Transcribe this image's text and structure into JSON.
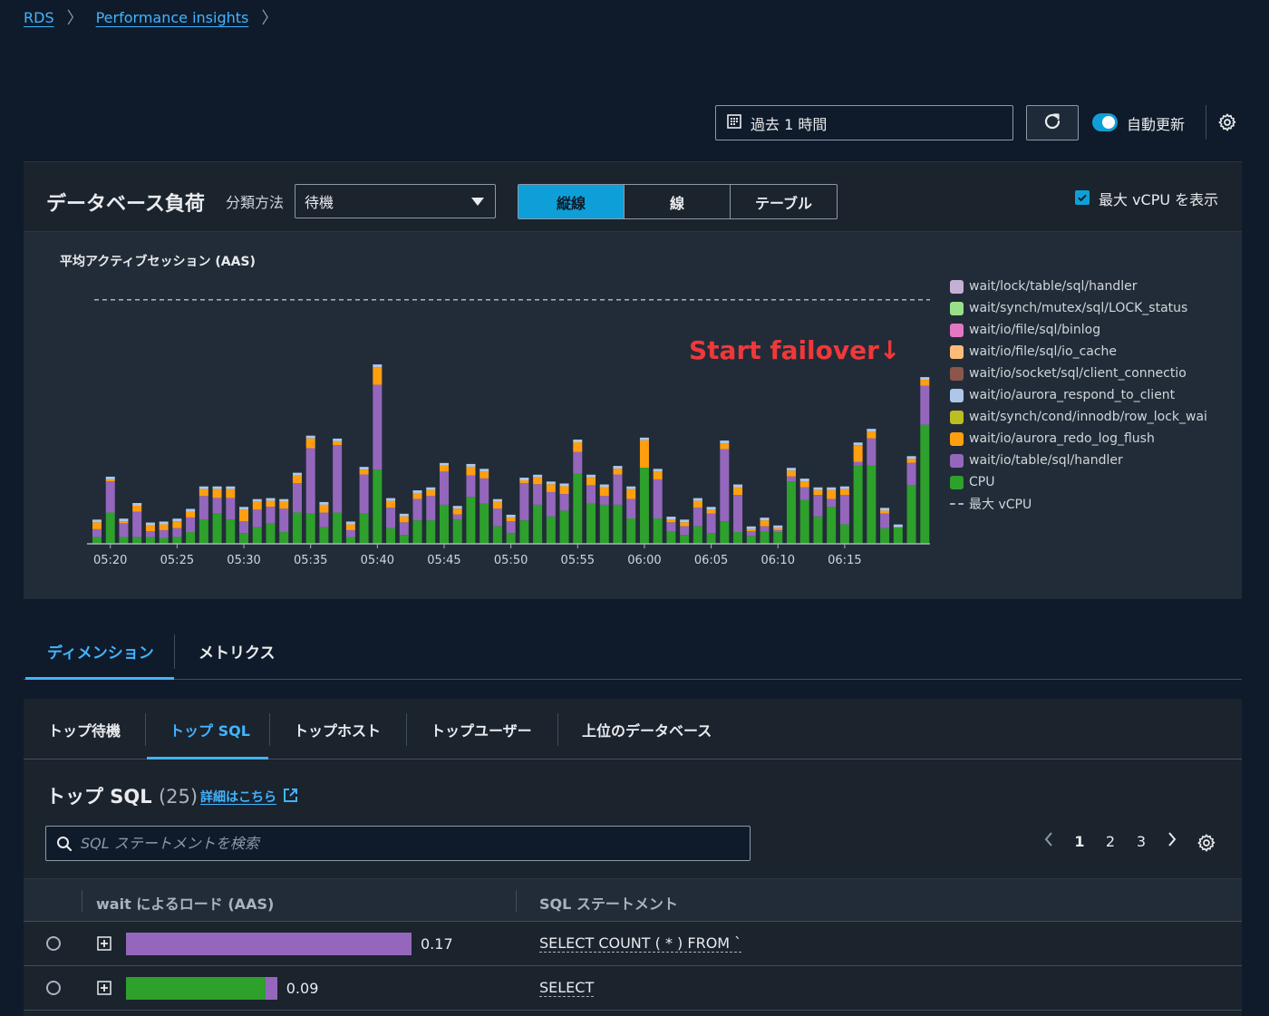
{
  "breadcrumb": [
    "RDS",
    "Performance insights"
  ],
  "time_range": {
    "label": "過去 1 時間"
  },
  "auto_refresh": {
    "label": "自動更新",
    "on": true
  },
  "panel": {
    "title": "データベース負荷",
    "group_by_label": "分類方法",
    "group_by_value": "待機",
    "view_modes": [
      "縦線",
      "線",
      "テーブル"
    ],
    "active_view": "縦線",
    "show_max_vcpu": {
      "label": "最大 vCPU を表示",
      "checked": true
    }
  },
  "annotation": "Start failover↓",
  "chart_data": {
    "type": "bar",
    "title": "平均アクティブセッション (AAS)",
    "stacked": true,
    "x_tick_labels": [
      "05:20",
      "05:25",
      "05:30",
      "05:35",
      "05:40",
      "05:45",
      "05:50",
      "05:55",
      "06:00",
      "06:05",
      "06:10",
      "06:15"
    ],
    "ylim": [
      0,
      2.6
    ],
    "max_vcpu": 2.5,
    "series_colors": {
      "CPU": "#2ea02c",
      "wait/io/table/sql/handler": "#9467bd",
      "wait/io/aurora_redo_log_flush": "#ff9f0f",
      "wait/synch/cond/innodb/row_lock_wai": "#bcbd22",
      "wait/io/aurora_respond_to_client": "#aec7e8",
      "wait/io/socket/sql/client_connectio": "#8c564b",
      "wait/io/file/sql/io_cache": "#ffbb78",
      "wait/io/file/sql/binlog": "#e377c2",
      "wait/synch/mutex/sql/LOCK_status": "#98df8a",
      "wait/lock/table/sql/handler": "#c5b0d5"
    },
    "bars": [
      {
        "CPU": 0.07,
        "handler": 0.08,
        "redo": 0.07
      },
      {
        "CPU": 0.32,
        "handler": 0.32,
        "redo": 0.02
      },
      {
        "CPU": 0.07,
        "handler": 0.14,
        "redo": 0.02
      },
      {
        "CPU": 0.07,
        "handler": 0.26,
        "redo": 0.06
      },
      {
        "CPU": 0.07,
        "handler": 0.06,
        "redo": 0.06
      },
      {
        "CPU": 0.06,
        "handler": 0.08,
        "redo": 0.06
      },
      {
        "CPU": 0.07,
        "handler": 0.09,
        "redo": 0.07
      },
      {
        "CPU": 0.12,
        "handler": 0.15,
        "redo": 0.06
      },
      {
        "CPU": 0.25,
        "handler": 0.24,
        "redo": 0.07
      },
      {
        "CPU": 0.31,
        "handler": 0.16,
        "redo": 0.09
      },
      {
        "CPU": 0.25,
        "handler": 0.22,
        "redo": 0.09
      },
      {
        "CPU": 0.11,
        "handler": 0.12,
        "redo": 0.12
      },
      {
        "CPU": 0.17,
        "handler": 0.18,
        "redo": 0.08
      },
      {
        "CPU": 0.21,
        "handler": 0.17,
        "redo": 0.06
      },
      {
        "CPU": 0.12,
        "handler": 0.24,
        "redo": 0.07
      },
      {
        "CPU": 0.32,
        "handler": 0.3,
        "redo": 0.08
      },
      {
        "CPU": 0.31,
        "handler": 0.67,
        "redo": 0.1
      },
      {
        "CPU": 0.17,
        "handler": 0.15,
        "redo": 0.08
      },
      {
        "CPU": 0.32,
        "handler": 0.69,
        "redo": 0.04
      },
      {
        "CPU": 0.07,
        "handler": 0.07,
        "redo": 0.06
      },
      {
        "CPU": 0.31,
        "handler": 0.4,
        "redo": 0.05
      },
      {
        "CPU": 0.76,
        "handler": 0.87,
        "redo": 0.18
      },
      {
        "CPU": 0.16,
        "handler": 0.21,
        "redo": 0.07
      },
      {
        "CPU": 0.09,
        "handler": 0.13,
        "redo": 0.06
      },
      {
        "CPU": 0.24,
        "handler": 0.22,
        "redo": 0.06
      },
      {
        "CPU": 0.24,
        "handler": 0.25,
        "redo": 0.06
      },
      {
        "CPU": 0.4,
        "handler": 0.34,
        "redo": 0.06
      },
      {
        "CPU": 0.25,
        "handler": 0.05,
        "redo": 0.06
      },
      {
        "CPU": 0.48,
        "handler": 0.22,
        "redo": 0.09
      },
      {
        "CPU": 0.41,
        "handler": 0.26,
        "redo": 0.07
      },
      {
        "CPU": 0.18,
        "handler": 0.18,
        "redo": 0.07
      },
      {
        "CPU": 0.11,
        "handler": 0.12,
        "redo": 0.04
      },
      {
        "CPU": 0.24,
        "handler": 0.38,
        "redo": 0.03
      },
      {
        "CPU": 0.4,
        "handler": 0.21,
        "redo": 0.07
      },
      {
        "CPU": 0.28,
        "handler": 0.25,
        "redo": 0.08
      },
      {
        "CPU": 0.34,
        "handler": 0.17,
        "redo": 0.08
      },
      {
        "CPU": 0.72,
        "handler": 0.22,
        "redo": 0.1
      },
      {
        "CPU": 0.41,
        "handler": 0.19,
        "redo": 0.08
      },
      {
        "CPU": 0.4,
        "handler": 0.09,
        "redo": 0.09
      },
      {
        "CPU": 0.4,
        "handler": 0.31,
        "redo": 0.06
      },
      {
        "CPU": 0.26,
        "handler": 0.2,
        "redo": 0.1
      },
      {
        "CPU": 0.78,
        "handler": 0.0,
        "redo": 0.28
      },
      {
        "CPU": 0.26,
        "handler": 0.4,
        "redo": 0.08
      },
      {
        "CPU": 0.13,
        "handler": 0.09,
        "redo": 0.03
      },
      {
        "CPU": 0.09,
        "handler": 0.09,
        "redo": 0.04
      },
      {
        "CPU": 0.18,
        "handler": 0.19,
        "redo": 0.07
      },
      {
        "CPU": 0.11,
        "handler": 0.2,
        "redo": 0.04
      },
      {
        "CPU": 0.23,
        "handler": 0.74,
        "redo": 0.06
      },
      {
        "CPU": 0.12,
        "handler": 0.38,
        "redo": 0.08
      },
      {
        "CPU": 0.08,
        "handler": 0.05,
        "redo": 0.02
      },
      {
        "CPU": 0.13,
        "handler": 0.05,
        "redo": 0.06
      },
      {
        "CPU": 0.12,
        "handler": 0.02,
        "redo": 0.02
      },
      {
        "CPU": 0.64,
        "handler": 0.05,
        "redo": 0.06
      },
      {
        "CPU": 0.45,
        "handler": 0.13,
        "redo": 0.06
      },
      {
        "CPU": 0.28,
        "handler": 0.22,
        "redo": 0.05
      },
      {
        "CPU": 0.38,
        "handler": 0.08,
        "redo": 0.09
      },
      {
        "CPU": 0.2,
        "handler": 0.3,
        "redo": 0.06
      },
      {
        "CPU": 0.8,
        "handler": 0.04,
        "redo": 0.17
      },
      {
        "CPU": 0.8,
        "handler": 0.28,
        "redo": 0.07
      },
      {
        "CPU": 0.16,
        "handler": 0.15,
        "redo": 0.03
      },
      {
        "CPU": 0.17,
        "handler": 0.0,
        "redo": 0.0
      },
      {
        "CPU": 0.6,
        "handler": 0.23,
        "redo": 0.04
      },
      {
        "CPU": 1.22,
        "handler": 0.4,
        "redo": 0.06
      }
    ]
  },
  "dimension_tabs": [
    "ディメンション",
    "メトリクス"
  ],
  "sub_tabs": [
    "トップ待機",
    "トップ SQL",
    "トップホスト",
    "トップユーザー",
    "上位のデータベース"
  ],
  "top_sql": {
    "title": "トップ SQL",
    "count": "(25)",
    "more_link": "詳細はこちら",
    "search_placeholder": "SQL ステートメントを検索",
    "pages": [
      "1",
      "2",
      "3"
    ],
    "current_page": "1",
    "columns": [
      "wait によるロード (AAS)",
      "SQL ステートメント"
    ],
    "rows": [
      {
        "load": "0.17",
        "purple": 0.17,
        "green": 0.0,
        "sql": "SELECT COUNT ( * ) FROM `"
      },
      {
        "load": "0.09",
        "purple": 0.007,
        "green": 0.083,
        "sql": "SELECT"
      }
    ]
  }
}
